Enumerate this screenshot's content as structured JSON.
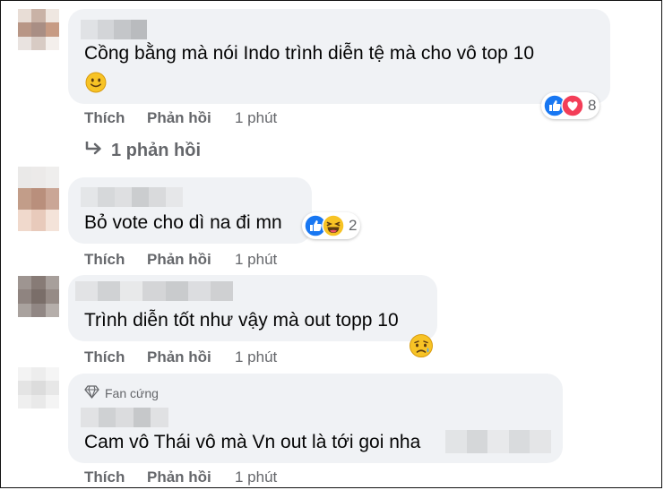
{
  "actions": {
    "like": "Thích",
    "reply": "Phản hồi"
  },
  "comments": [
    {
      "text_line1": "Cồng bằng mà nói Indo trình diễn tệ mà cho vô top 10",
      "time": "1 phút",
      "reaction_count": "8",
      "replies_label": "1 phản hồi"
    },
    {
      "text_line1": "Bỏ vote cho dì na đi mn",
      "time": "1 phút",
      "reaction_count": "2"
    },
    {
      "text_line1": "Trình diễn tốt như vậy mà out topp 10",
      "time": "1 phút"
    },
    {
      "badge": "Fan cứng",
      "text_line1": "Cam vô Thái vô mà Vn out là tới goi nha",
      "time": "1 phút"
    }
  ],
  "colors": {
    "bubble": "#f0f2f5",
    "meta": "#65676b",
    "like_blue": "#1877f2",
    "love_red": "#f33e58",
    "emoji_yellow": "#f7c325"
  }
}
